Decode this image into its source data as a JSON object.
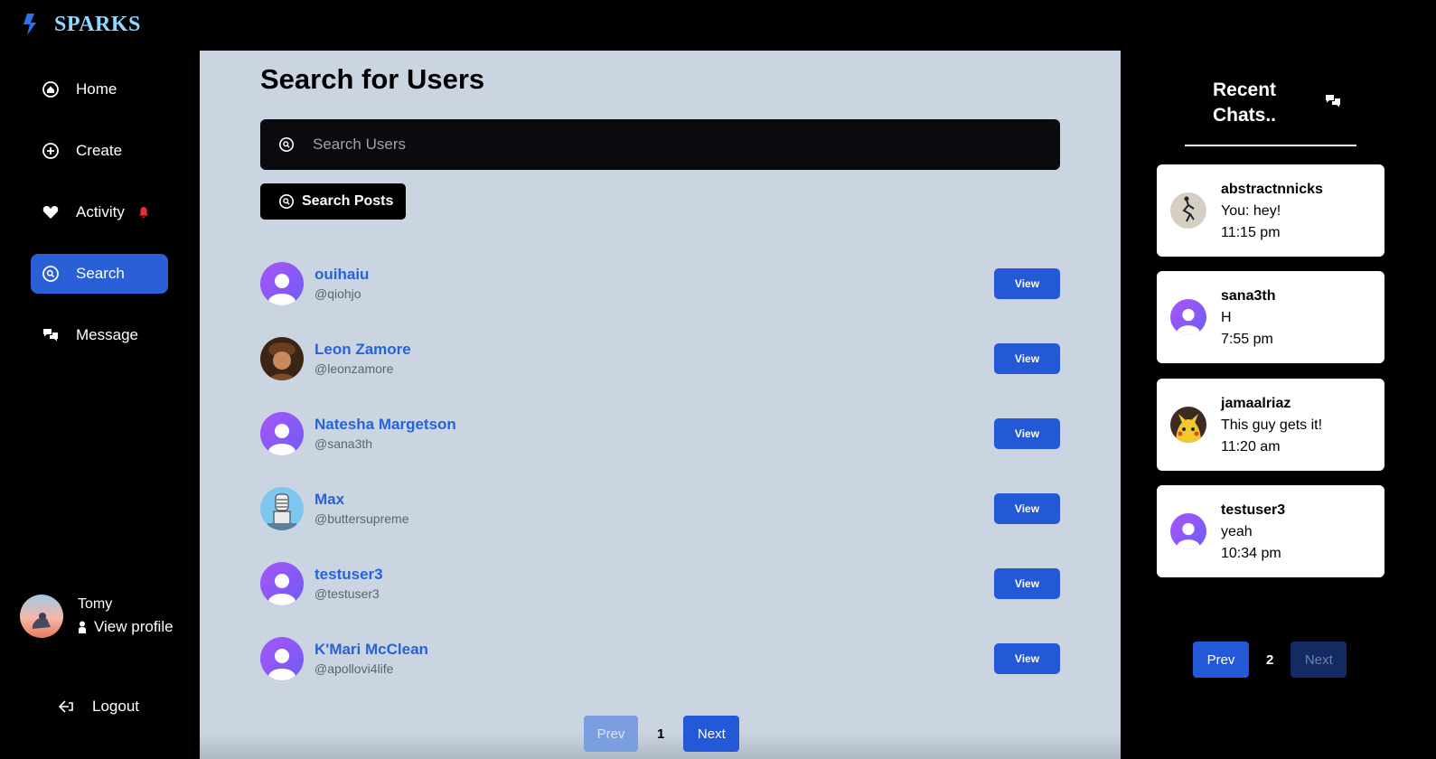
{
  "brand": {
    "name": "SPARKS",
    "accent": "#2563eb",
    "name_color": "#8fd9ff"
  },
  "sidebar": {
    "items": [
      {
        "label": "Home",
        "icon": "home-icon"
      },
      {
        "label": "Create",
        "icon": "plus-circle-icon"
      },
      {
        "label": "Activity",
        "icon": "heart-icon",
        "badge_icon": "bell-icon"
      },
      {
        "label": "Search",
        "icon": "search-icon",
        "active": true
      },
      {
        "label": "Message",
        "icon": "chat-bubbles-icon"
      }
    ],
    "profile": {
      "name": "Tomy",
      "link": "View profile"
    },
    "logout": "Logout"
  },
  "main": {
    "title": "Search for Users",
    "search": {
      "placeholder": "Search Users",
      "value": ""
    },
    "search_posts_label": "Search Posts",
    "users": [
      {
        "name": "ouihaiu",
        "handle": "@qiohjo",
        "view": "View",
        "avatar": "default"
      },
      {
        "name": "Leon Zamore",
        "handle": "@leonzamore",
        "view": "View",
        "avatar": "photo-brown"
      },
      {
        "name": "Natesha Margetson",
        "handle": "@sana3th",
        "view": "View",
        "avatar": "default"
      },
      {
        "name": "Max",
        "handle": "@buttersupreme",
        "view": "View",
        "avatar": "photo-sky"
      },
      {
        "name": "testuser3",
        "handle": "@testuser3",
        "view": "View",
        "avatar": "default"
      },
      {
        "name": "K'Mari McClean",
        "handle": "@apollovi4life",
        "view": "View",
        "avatar": "default"
      }
    ],
    "pagination": {
      "prev": "Prev",
      "page": "1",
      "next": "Next"
    }
  },
  "recent_chats": {
    "title_line1": "Recent",
    "title_line2": "Chats..",
    "icon": "chat-bubbles-icon",
    "chats": [
      {
        "name": "abstractnnicks",
        "message": "You: hey!",
        "time": "11:15 pm",
        "avatar": "photo-sketch"
      },
      {
        "name": "sana3th",
        "message": "H",
        "time": "7:55 pm",
        "avatar": "default"
      },
      {
        "name": "jamaalriaz",
        "message": "This guy gets it!",
        "time": "11:20 am",
        "avatar": "photo-pikachu"
      },
      {
        "name": "testuser3",
        "message": "yeah",
        "time": "10:34 pm",
        "avatar": "default"
      }
    ],
    "pagination": {
      "prev": "Prev",
      "page": "2",
      "next": "Next"
    }
  },
  "colors": {
    "primary_button": "#2358d6",
    "main_background": "#cbd5e1",
    "default_avatar_gradient": [
      "#a855f7",
      "#6366f1"
    ]
  }
}
